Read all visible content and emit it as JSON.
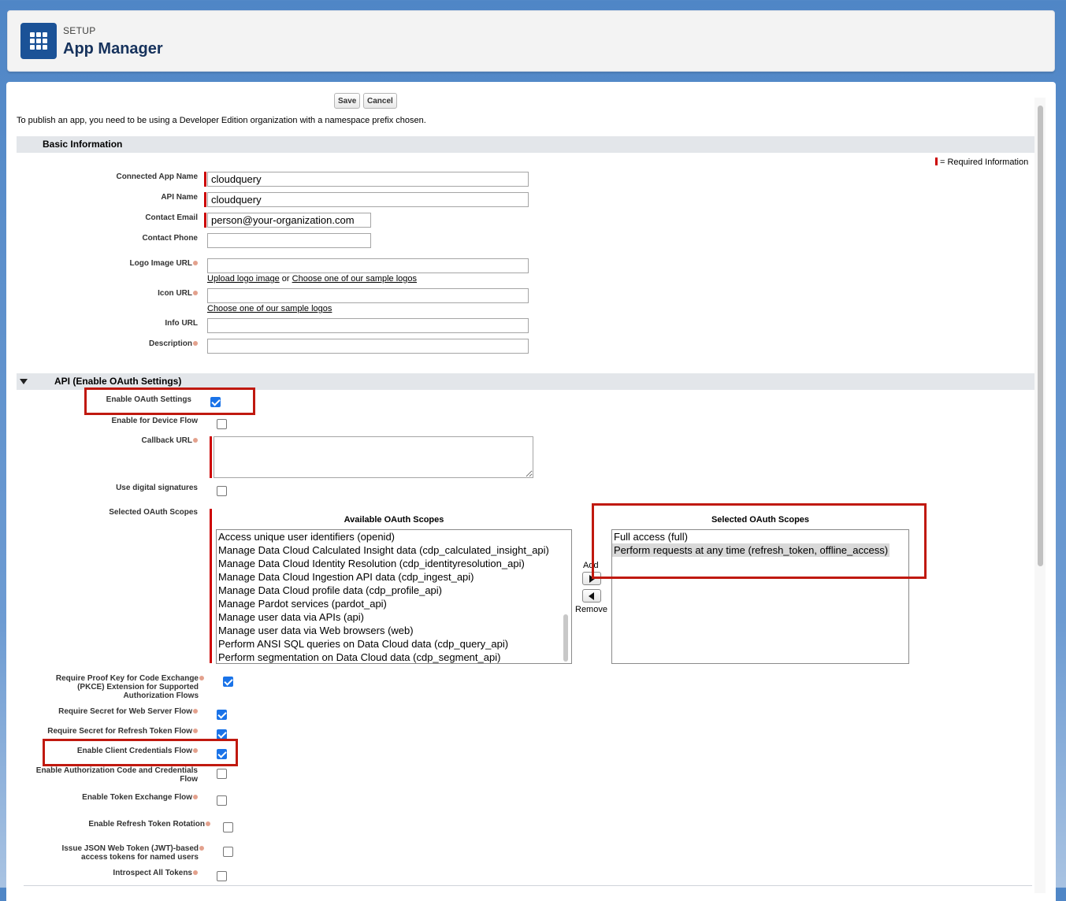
{
  "header": {
    "setup_label": "SETUP",
    "title": "App Manager",
    "icon": "app-launcher-grid-icon"
  },
  "toolbar": {
    "save_label": "Save",
    "cancel_label": "Cancel"
  },
  "note": "To publish an app, you need to be using a Developer Edition organization with a namespace prefix chosen.",
  "basic": {
    "section_title": "Basic Information",
    "required_info": "= Required Information",
    "connected_app_name_label": "Connected App Name",
    "connected_app_name_value": "cloudquery",
    "api_name_label": "API Name",
    "api_name_value": "cloudquery",
    "contact_email_label": "Contact Email",
    "contact_email_value": "person@your-organization.com",
    "contact_phone_label": "Contact Phone",
    "logo_label": "Logo Image URL",
    "upload_logo": "Upload logo image",
    "or_text": "or",
    "choose_sample_logos": "Choose one of our sample logos",
    "icon_label": "Icon URL",
    "choose_sample_logos_2": "Choose one of our sample logos",
    "info_label": "Info URL",
    "description_label": "Description"
  },
  "api": {
    "section_title": "API (Enable OAuth Settings)",
    "enable_oauth_label": "Enable OAuth Settings",
    "device_flow_label": "Enable for Device Flow",
    "callback_label": "Callback URL",
    "digital_sig_label": "Use digital signatures",
    "scopes_label": "Selected OAuth Scopes",
    "available_title": "Available OAuth Scopes",
    "selected_title": "Selected OAuth Scopes",
    "available_scopes": [
      "Access unique user identifiers (openid)",
      "Manage Data Cloud Calculated Insight data (cdp_calculated_insight_api)",
      "Manage Data Cloud Identity Resolution (cdp_identityresolution_api)",
      "Manage Data Cloud Ingestion API data (cdp_ingest_api)",
      "Manage Data Cloud profile data (cdp_profile_api)",
      "Manage Pardot services (pardot_api)",
      "Manage user data via APIs (api)",
      "Manage user data via Web browsers (web)",
      "Perform ANSI SQL queries on Data Cloud data (cdp_query_api)",
      "Perform segmentation on Data Cloud data (cdp_segment_api)"
    ],
    "selected_scopes": [
      "Full access (full)",
      "Perform requests at any time (refresh_token, offline_access)"
    ],
    "add_label": "Add",
    "remove_label": "Remove",
    "pkce_label_1": "Require Proof Key for Code Exchange",
    "pkce_label_2": "(PKCE) Extension for Supported",
    "pkce_label_3": "Authorization Flows",
    "secret_web_label": "Require Secret for Web Server Flow",
    "secret_refresh_label": "Require Secret for Refresh Token Flow",
    "client_cred_label": "Enable Client Credentials Flow",
    "auth_code_label_1": "Enable Authorization Code and Credentials",
    "auth_code_label_2": "Flow",
    "token_exchange_label": "Enable Token Exchange Flow",
    "refresh_rotation_label": "Enable Refresh Token Rotation",
    "jwt_label_1": "Issue JSON Web Token (JWT)-based",
    "jwt_label_2": "access tokens for named users",
    "introspect_label": "Introspect All Tokens"
  },
  "colors": {
    "required": "#c00000",
    "highlight": "#c0190f",
    "brand": "#1b5297",
    "checkbox": "#1a73e8"
  }
}
